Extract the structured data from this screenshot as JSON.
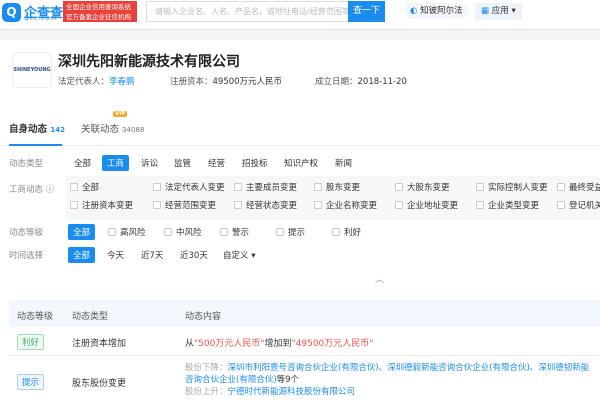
{
  "header": {
    "logo_text": "企查查",
    "logo_sub": "Qcc.com",
    "badge_line1": "全国企业信用查询系统",
    "badge_line2": "官方备案企业征信机构",
    "search_placeholder": "请输入企业名、人名、产品名，或地址电话/经营范围等",
    "search_button": "查一下",
    "zhibi": "知彼阿尔法",
    "apps": "应用"
  },
  "company": {
    "logo_text": "SHINEYOUNG",
    "name": "深圳先阳新能源技术有限公司",
    "rep_label": "法定代表人：",
    "rep": "李春鹏",
    "capital_label": "注册资本：",
    "capital": "49500万元人民币",
    "date_label": "成立日期：",
    "date": "2018-11-20"
  },
  "tabs": [
    {
      "label": "自身动态",
      "count": "142"
    },
    {
      "label": "关联动态",
      "count": "34088",
      "badge": "VIP"
    }
  ],
  "filters": {
    "type_label": "动态类型",
    "types": [
      "全部",
      "工商",
      "诉讼",
      "监管",
      "经营",
      "招投标",
      "知识产权",
      "新闻"
    ],
    "biz_label": "工商动态",
    "biz_row1": [
      "全部",
      "法定代表人变更",
      "主要成员变更",
      "股东变更",
      "大股东变更",
      "实际控制人变更",
      "最终受益"
    ],
    "biz_row2": [
      "注册资本变更",
      "经营范围变更",
      "经营状态变更",
      "企业名称变更",
      "企业地址变更",
      "企业类型变更",
      "登记机关"
    ],
    "level_label": "动态等级",
    "levels": [
      "全部",
      "高风险",
      "中风险",
      "警示",
      "提示",
      "利好"
    ],
    "time_label": "时间选择",
    "times": [
      "全部",
      "今天",
      "近7天",
      "近30天",
      "自定义"
    ]
  },
  "table": {
    "headers": [
      "动态等级",
      "动态类型",
      "动态内容"
    ],
    "rows": [
      {
        "level": "利好",
        "type": "注册资本增加",
        "c1": "从",
        "c2": "\"500万元人民币\"",
        "c3": "增加到",
        "c4": "\"49500万元人民币\""
      },
      {
        "level": "提示",
        "type": "股东股份变更",
        "down_label": "股份下降：",
        "down1": "深圳市利阳壹号咨询合伙企业(有限合伙)、深圳德毅新能咨询合伙企业(有限合伙)、深圳德韧新能",
        "down2": "咨询合伙企业(有限合伙)",
        "down_suffix": "等9个",
        "up_label": "股份上升：",
        "up": "宁德时代新能源科技股份有限公司"
      }
    ]
  }
}
